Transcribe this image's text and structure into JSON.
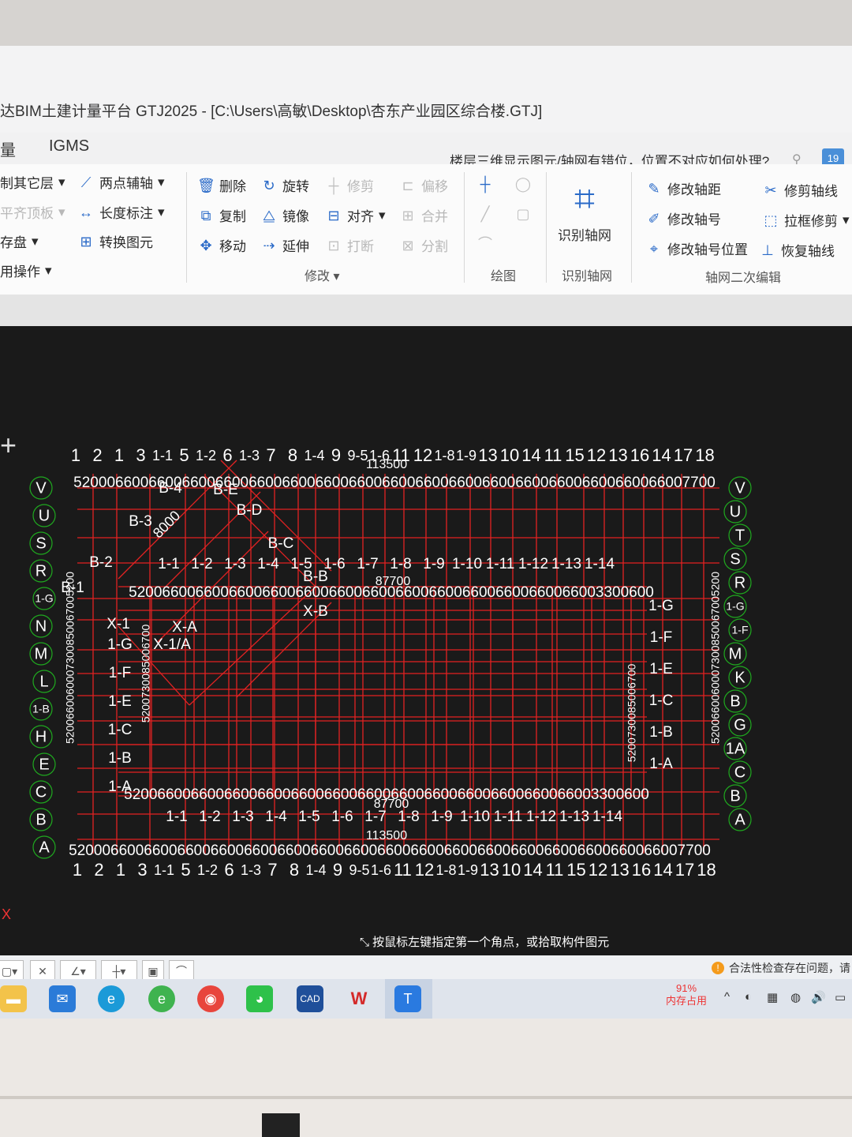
{
  "window": {
    "title": "达BIM土建计量平台 GTJ2025 - [C:\\Users\\高敏\\Desktop\\杏东产业园区综合楼.GTJ]"
  },
  "menu": {
    "items": [
      "量",
      "IGMS"
    ]
  },
  "help": {
    "question": "楼层三维显示图元/轴网有错位，位置不对应如何处理?",
    "user_badge": "19"
  },
  "ribbon": {
    "left_col": [
      "制其它层",
      "平齐顶板",
      "存盘",
      "用操作"
    ],
    "aux": {
      "two_point_axis": "两点辅轴",
      "length_dim": "长度标注",
      "convert": "转换图元"
    },
    "modify": {
      "delete": "删除",
      "rotate": "旋转",
      "trim": "修剪",
      "offset": "偏移",
      "copy": "复制",
      "mirror": "镜像",
      "align": "对齐",
      "merge": "合并",
      "move": "移动",
      "extend": "延伸",
      "break": "打断",
      "split": "分割",
      "group_label": "修改"
    },
    "draw": {
      "group_label": "绘图"
    },
    "identify": {
      "button": "识别轴网",
      "group_label": "识别轴网"
    },
    "axis_edit": {
      "modify_spacing": "修改轴距",
      "trim_axis": "修剪轴线",
      "modify_number": "修改轴号",
      "box_trim": "拉框修剪",
      "modify_number_pos": "修改轴号位置",
      "restore_axis": "恢复轴线",
      "group_label": "轴网二次编辑"
    }
  },
  "canvas": {
    "top_axis_labels": [
      "1",
      "2",
      "1",
      "3",
      "1-1",
      "5",
      "1-2",
      "6",
      "1-3",
      "7",
      "8",
      "1-4",
      "9",
      "9-5",
      "1-6",
      "11",
      "12",
      "1-8",
      "1-9",
      "13",
      "10",
      "14",
      "11",
      "15",
      "12",
      "13",
      "16",
      "14",
      "17",
      "18"
    ],
    "left_axis_labels": [
      "V",
      "U",
      "S",
      "R",
      "1-G",
      "N",
      "M",
      "L",
      "1-B",
      "H",
      "E",
      "C",
      "B",
      "A"
    ],
    "right_axis_labels": [
      "V",
      "U",
      "T",
      "S",
      "R",
      "1-G",
      "1-F",
      "M",
      "K",
      "B",
      "G",
      "1A",
      "C",
      "B",
      "A"
    ],
    "inner_axis_labels": [
      "1-1",
      "1-2",
      "1-3",
      "1-4",
      "1-5",
      "1-6",
      "1-7",
      "1-8",
      "1-9",
      "1-10",
      "1-11",
      "1-12",
      "1-13",
      "1-14"
    ],
    "inner_row_labels": [
      "1-G",
      "1-F",
      "1-E",
      "1-C",
      "1-B",
      "1-A"
    ],
    "diag_labels": [
      "B-4",
      "B-E",
      "B-D",
      "B-3",
      "B-C",
      "B-2",
      "B-B",
      "B-1",
      "X-A",
      "X-1",
      "X-1/A",
      "X-B"
    ],
    "dim_top": "52000660066006600660066006600660066006600660066006600660066006600660066007700",
    "dim_top_total": "113500",
    "dim_inner": "520066006600660066006600660066006600660066006600660066003300600",
    "dim_inner_total": "87700",
    "dim_left": "5200660060007300850067005200",
    "dim_right": "5200730085006700",
    "dim_diag": "8000"
  },
  "status": {
    "prompt": "按鼠标左键指定第一个角点，或拾取构件图元"
  },
  "warning": {
    "text": "合法性检查存在问题，请"
  },
  "taskbar": {
    "memory_percent": "91%",
    "memory_label": "内存占用"
  },
  "colors": {
    "grid": "#e32222",
    "axis_circle": "#1faa1f",
    "canvas_bg": "#1a1a1a",
    "accent": "#2a6ac8"
  }
}
